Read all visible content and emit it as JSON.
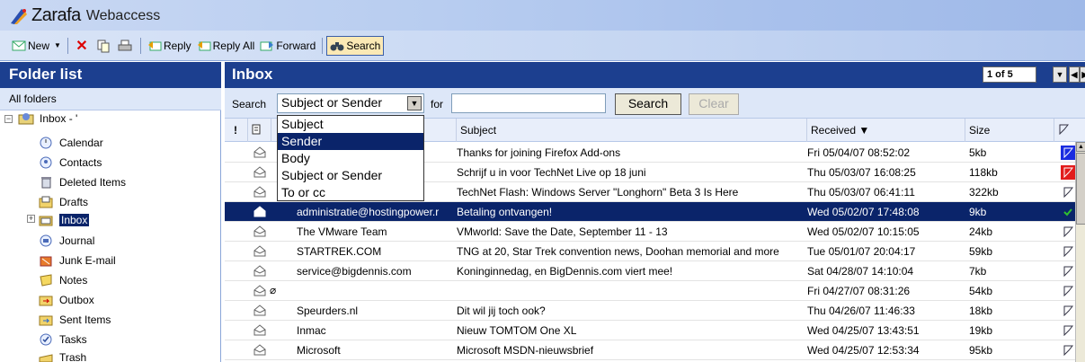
{
  "app": {
    "brand": "Zarafa",
    "product": "Webaccess"
  },
  "toolbar": {
    "new_label": "New",
    "reply_label": "Reply",
    "reply_all_label": "Reply All",
    "forward_label": "Forward",
    "search_label": "Search"
  },
  "sidebar": {
    "title": "Folder list",
    "all_folders": "All folders",
    "root": "Inbox - '",
    "items": [
      {
        "label": "Calendar",
        "icon": "calendar-icon"
      },
      {
        "label": "Contacts",
        "icon": "contacts-icon"
      },
      {
        "label": "Deleted Items",
        "icon": "trash-icon"
      },
      {
        "label": "Drafts",
        "icon": "drafts-icon"
      },
      {
        "label": "Inbox",
        "icon": "inbox-icon"
      },
      {
        "label": "Journal",
        "icon": "journal-icon"
      },
      {
        "label": "Junk E-mail",
        "icon": "junk-icon"
      },
      {
        "label": "Notes",
        "icon": "notes-icon"
      },
      {
        "label": "Outbox",
        "icon": "outbox-icon"
      },
      {
        "label": "Sent Items",
        "icon": "sent-icon"
      },
      {
        "label": "Tasks",
        "icon": "tasks-icon"
      },
      {
        "label": "Trash",
        "icon": "trash-folder-icon"
      }
    ]
  },
  "main": {
    "title": "Inbox",
    "pager": "1 of 5",
    "search": {
      "label": "Search",
      "scope_value": "Subject or Sender",
      "for_label": "for",
      "button": "Search",
      "clear": "Clear",
      "options": [
        "Subject",
        "Sender",
        "Body",
        "Subject or Sender",
        "To or cc"
      ]
    },
    "columns": {
      "importance": "!",
      "subject": "Subject",
      "received": "Received ▼",
      "size": "Size"
    },
    "rows": [
      {
        "from": "",
        "subject": "Thanks for joining Firefox Add-ons",
        "received": "Fri 05/04/07 08:52:02",
        "size": "5kb",
        "flag": "blue"
      },
      {
        "from": "",
        "subject": "Schrijf u in voor TechNet Live op 18 juni",
        "received": "Thu 05/03/07 16:08:25",
        "size": "118kb",
        "flag": "red"
      },
      {
        "from": "",
        "subject": "TechNet Flash: Windows Server \"Longhorn\" Beta 3 Is Here",
        "received": "Thu 05/03/07 06:41:11",
        "size": "322kb",
        "flag": "none"
      },
      {
        "from": "administratie@hostingpower.r",
        "subject": "Betaling ontvangen!",
        "received": "Wed 05/02/07 17:48:08",
        "size": "9kb",
        "flag": "check"
      },
      {
        "from": "The VMware Team",
        "subject": "VMworld: Save the Date, September 11 - 13",
        "received": "Wed 05/02/07 10:15:05",
        "size": "24kb",
        "flag": "none"
      },
      {
        "from": "STARTREK.COM",
        "subject": "TNG at 20, Star Trek convention news, Doohan memorial and more",
        "received": "Tue 05/01/07 20:04:17",
        "size": "59kb",
        "flag": "none"
      },
      {
        "from": "service@bigdennis.com",
        "subject": "Koninginnedag, en BigDennis.com viert mee!",
        "received": "Sat 04/28/07 14:10:04",
        "size": "7kb",
        "flag": "none"
      },
      {
        "from": "",
        "subject": "",
        "received": "Fri 04/27/07 08:31:26",
        "size": "54kb",
        "flag": "none"
      },
      {
        "from": "Speurders.nl",
        "subject": "Dit wil jij toch ook?",
        "received": "Thu 04/26/07 11:46:33",
        "size": "18kb",
        "flag": "none"
      },
      {
        "from": "Inmac",
        "subject": "Nieuw TOMTOM One XL",
        "received": "Wed 04/25/07 13:43:51",
        "size": "19kb",
        "flag": "none"
      },
      {
        "from": "Microsoft",
        "subject": "Microsoft MSDN-nieuwsbrief",
        "received": "Wed 04/25/07 12:53:34",
        "size": "95kb",
        "flag": "none"
      }
    ]
  },
  "colors": {
    "header_blue": "#1c3f8f",
    "selection": "#0a246a",
    "flag_red": "#e21c1c",
    "flag_blue": "#1a2be0"
  }
}
